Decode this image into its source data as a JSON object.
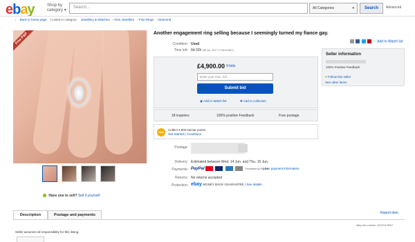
{
  "header": {
    "logo": {
      "e": "e",
      "b": "b",
      "a": "a",
      "y": "y"
    },
    "shop_by_category": "Shop by category",
    "search_placeholder": "Search...",
    "category_select": "All Categories",
    "search_button": "Search",
    "advanced": "Advanced"
  },
  "breadcrumbs": {
    "back": "Back to home page",
    "listed_in": "| Listed in category:",
    "path": [
      "Jewellery & Watches",
      "Fine Jewellery",
      "Fine Rings",
      "Diamond"
    ]
  },
  "gallery": {
    "ribbon": "Free P&P",
    "have_one": "Have one to sell?",
    "sell_it": "Sell it yourself"
  },
  "listing": {
    "title": "Another engagement ring selling because I seemingly turned my fiance gay.",
    "share_add_watch": "Add to Watch list",
    "condition_label": "Condition:",
    "condition_value": "Used",
    "time_left_label": "Time left:",
    "time_left_value": "8d 02h",
    "time_left_date": "(08 Jun, 2017  17:06:16 BST)"
  },
  "bid": {
    "price": "£4,900.00",
    "bids": "9 bids",
    "max_bid_placeholder": "Enter your max. bid",
    "submit": "Submit bid",
    "add_watch": "Add to Watch list",
    "add_collection": "Add to collection"
  },
  "stats": {
    "inquiries": "18 inquiries",
    "feedback": "100% positive Feedback",
    "postage": "Free postage"
  },
  "reward": {
    "badge": "ebay",
    "collect": "Collect 4,900 Nectar points",
    "get_started": "Get Started",
    "conditions": "| Conditions"
  },
  "details": {
    "postage_label": "Postage:",
    "delivery_label": "Delivery:",
    "delivery_value": "Estimated between Wed. 14 Jun. and Thu. 15 Jun.",
    "payments_label": "Payments:",
    "paypal": "PayPal",
    "processed_by": "Processed by PayPal",
    "payment_info": "| See payment information",
    "returns_label": "Returns:",
    "returns_value": "No returns accepted",
    "protection_label": "Protection:",
    "protection_logo": "ebay",
    "money_back": "MONEY BACK GUARANTEE",
    "see_details": "| See details"
  },
  "seller": {
    "heading": "Seller information",
    "positive_feedback": "100% Positive Feedback",
    "follow": "Follow this seller",
    "other_items": "See other items"
  },
  "tabs": {
    "description": "Description",
    "postage_payments": "Postage and payments",
    "report_item": "Report item",
    "item_number": "eBay item number:   192201178917",
    "assumes": "Seller assumes all responsibility for this listing."
  },
  "colors": {
    "ebay_red": "#e53238",
    "ebay_blue": "#0064d2",
    "ebay_yellow": "#f5af02",
    "ebay_green": "#86b817",
    "link_blue": "#0654ba"
  }
}
